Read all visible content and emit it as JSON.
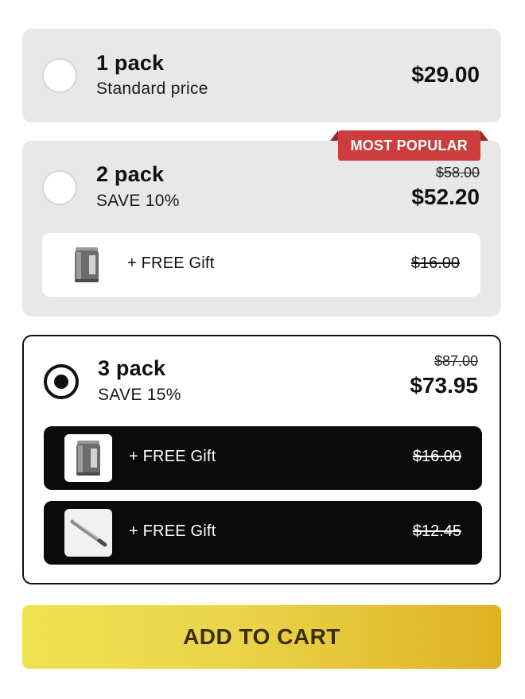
{
  "options": [
    {
      "title": "1 pack",
      "subtitle": "Standard price",
      "price": "$29.00",
      "selected": false
    },
    {
      "title": "2 pack",
      "subtitle": "SAVE 10%",
      "old_price": "$58.00",
      "price": "$52.20",
      "badge": "MOST POPULAR",
      "selected": false,
      "gifts": [
        {
          "label": "+ FREE Gift",
          "price": "$16.00",
          "icon": "can-icon"
        }
      ]
    },
    {
      "title": "3 pack",
      "subtitle": "SAVE 15%",
      "old_price": "$87.00",
      "price": "$73.95",
      "selected": true,
      "gifts": [
        {
          "label": "+ FREE Gift",
          "price": "$16.00",
          "icon": "can-icon"
        },
        {
          "label": "+ FREE Gift",
          "price": "$12.45",
          "icon": "pen-icon"
        }
      ]
    }
  ],
  "cart_button": {
    "label": "ADD TO CART"
  },
  "colors": {
    "card_bg": "#e8e8e8",
    "selected_border": "#111111",
    "badge": "#cc3d3d",
    "dark_gift": "#0b0b0b",
    "cart_gradient_start": "#efe351",
    "cart_gradient_end": "#dfb124",
    "cart_text": "#3a2e08"
  }
}
